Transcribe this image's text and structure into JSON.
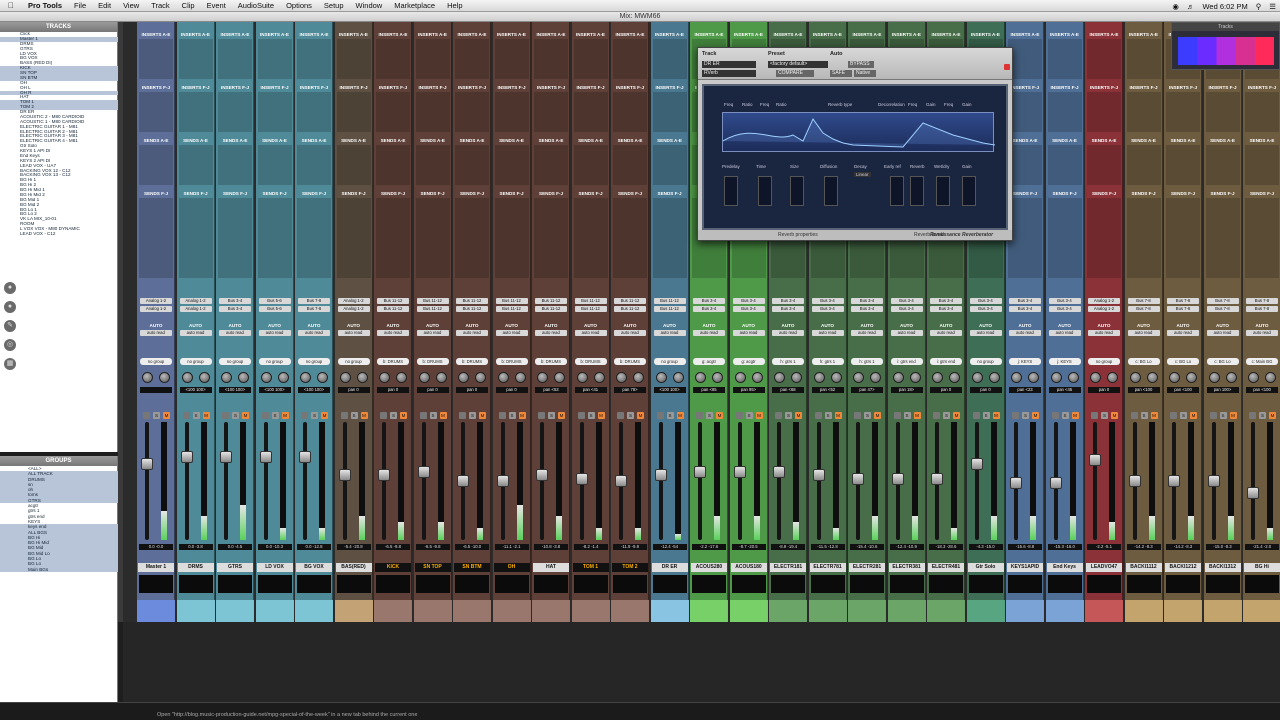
{
  "menubar": {
    "app": "Pro Tools",
    "items": [
      "File",
      "Edit",
      "View",
      "Track",
      "Clip",
      "Event",
      "AudioSuite",
      "Options",
      "Setup",
      "Window",
      "Marketplace",
      "Help"
    ],
    "clock": "Wed 6:02 PM"
  },
  "window_title": "Mix: MWM66",
  "tracks_panel": {
    "title": "TRACKS",
    "rows": [
      "Click",
      "Master 1",
      "DRMS",
      "GTRS",
      "LD VOX",
      "BG VOX",
      "BASS (RED DI)",
      "KICK",
      "SN TOP",
      "SN BTM",
      "OH",
      "OH L",
      "OH R",
      "HAT",
      "TOM 1",
      "TOM 2",
      "DR ER",
      "ACOUSTIC 2 - M80 CARDIOID",
      "ACOUSTIC 1 - M80 CARDIOID",
      "ELECTRIC GUITAR 1 - M81",
      "ELECTRIC GUITAR 2 - M81",
      "ELECTRIC GUITAR 3 - M81",
      "ELECTRIC GUITAR 4 - M81",
      "Gtr Solo",
      "KEYS 1 API DI",
      "End Keys",
      "KEYS 2 API DI",
      "LEAD VOX - UA7",
      "BACKING VOX 12 - C12",
      "BACKING VOX 13 - C12",
      "BG Hi 1",
      "BG Hi 2",
      "BG Hi Mid 1",
      "BG Hi Mid 2",
      "BG Mid 1",
      "BG Mid 2",
      "BG Lo 1",
      "BG Lo 2",
      "VK LA MIX_10-01",
      "ROOM",
      "L VOX VOX - M80 DYNAMIC",
      "LEAD VOX - C12"
    ],
    "selected": [
      1,
      7,
      8,
      9,
      12,
      14,
      15
    ]
  },
  "groups_panel": {
    "title": "GROUPS",
    "rows": [
      "<ALL>",
      "ALL TRACK",
      "DRUMS",
      "sn",
      "oh",
      "toms",
      "GTRS",
      "acgtr",
      "gtrs 1",
      "gtrs end",
      "KEYS",
      "keys end",
      "ALL BGS",
      "BG Hi",
      "BG Hi Mid",
      "BG Mid",
      "BG Mid Lo",
      "BG Lo",
      "BG Lo",
      "Main BGs"
    ],
    "selected": [
      1,
      2,
      3,
      4,
      5,
      6,
      11,
      12,
      13,
      14,
      15,
      16,
      17,
      18,
      19
    ]
  },
  "mixer": {
    "inserts_label": "INSERTS A-E",
    "inserts_fj_label": "INSERTS F-J",
    "sends_label": "SENDS A-E",
    "sends_fj_label": "SENDS F-J",
    "auto_label": "AUTO",
    "auto_mode": "auto read",
    "strips": [
      {
        "name": "Master 1",
        "color": "#5d6f98",
        "swatch": "#6e8ce0",
        "io": "Analog 1-2",
        "grp": "no group",
        "pan": "",
        "vol": "0.0  -0.0",
        "fader": 0.36,
        "meter": 0.25,
        "sel": false
      },
      {
        "name": "DRMS",
        "color": "#4f8a98",
        "swatch": "#7fc8d8",
        "io": "Analog 1-2",
        "grp": "no group",
        "pan": "<100 100>",
        "vol": "0.0  -3.8",
        "fader": 0.3,
        "meter": 0.2,
        "sel": false
      },
      {
        "name": "GTRS",
        "color": "#4f8a98",
        "swatch": "#7fc8d8",
        "io": "Bus 3-4",
        "grp": "no group",
        "pan": "<100 100>",
        "vol": "0.0  -4.5",
        "fader": 0.3,
        "meter": 0.3,
        "sel": false
      },
      {
        "name": "LD VOX",
        "color": "#4f8a98",
        "swatch": "#7fc8d8",
        "io": "Bus 5-6",
        "grp": "no group",
        "pan": "<100 100>",
        "vol": "0.0  -10.3",
        "fader": 0.3,
        "meter": 0.1,
        "sel": false
      },
      {
        "name": "BG VOX",
        "color": "#4f8a98",
        "swatch": "#7fc8d8",
        "io": "Bus 7-8",
        "grp": "no group",
        "pan": "<100 100>",
        "vol": "0.0  -12.8",
        "fader": 0.3,
        "meter": 0.1,
        "sel": false
      },
      {
        "name": "BAS(RED)",
        "color": "#5e5143",
        "swatch": "#c8a878",
        "io": "Analog 1-2",
        "grp": "no group",
        "pan": "pan  0",
        "vol": "-5.4  -20.8",
        "fader": 0.45,
        "meter": 0.2,
        "sel": false
      },
      {
        "name": "KICK",
        "color": "#5e4038",
        "swatch": "#9c7a70",
        "io": "Bus 11-12",
        "grp": "b: DRUMS",
        "pan": "pan  0",
        "vol": "-6.5  -9.8",
        "fader": 0.45,
        "meter": 0.15,
        "sel": true
      },
      {
        "name": "SN TOP",
        "color": "#5e4038",
        "swatch": "#9c7a70",
        "io": "Bus 11-12",
        "grp": "b: DRUMS",
        "pan": "pan  0",
        "vol": "-6.5  -9.8",
        "fader": 0.42,
        "meter": 0.15,
        "sel": true
      },
      {
        "name": "SN BTM",
        "color": "#5e4038",
        "swatch": "#9c7a70",
        "io": "Bus 11-12",
        "grp": "b: DRUMS",
        "pan": "pan  0",
        "vol": "-6.5  -10.0",
        "fader": 0.5,
        "meter": 0.1,
        "sel": true
      },
      {
        "name": "OH",
        "color": "#5e4038",
        "swatch": "#9c7a70",
        "io": "Bus 11-12",
        "grp": "b: DRUMS",
        "pan": "pan  0",
        "vol": "-11.1  -2.1",
        "fader": 0.5,
        "meter": 0.3,
        "sel": true
      },
      {
        "name": "HAT",
        "color": "#5e4038",
        "swatch": "#9c7a70",
        "io": "Bus 11-12",
        "grp": "b: DRUMS",
        "pan": "pan  <53",
        "vol": "-10.8  -3.8",
        "fader": 0.45,
        "meter": 0.2,
        "sel": false
      },
      {
        "name": "TOM 1",
        "color": "#5e4038",
        "swatch": "#9c7a70",
        "io": "Bus 11-12",
        "grp": "b: DRUMS",
        "pan": "pan  <41",
        "vol": "-8.2  -1.4",
        "fader": 0.48,
        "meter": 0.1,
        "sel": true
      },
      {
        "name": "TOM 2",
        "color": "#5e4038",
        "swatch": "#9c7a70",
        "io": "Bus 11-12",
        "grp": "b: DRUMS",
        "pan": "pan  78>",
        "vol": "-11.9  -9.9",
        "fader": 0.5,
        "meter": 0.1,
        "sel": true
      },
      {
        "name": "DR ER",
        "color": "#4a7890",
        "swatch": "#8cc8e8",
        "io": "Bus 11-12",
        "grp": "no group",
        "pan": "<100 100>",
        "vol": "-12.4  -54",
        "fader": 0.45,
        "meter": 0.05,
        "sel": false
      },
      {
        "name": "ACOUS280",
        "color": "#4f9a48",
        "swatch": "#7ad46a",
        "io": "Bus 3-4",
        "grp": "g: acgtr",
        "pan": "pan  <85",
        "vol": "-2.2  -17.6",
        "fader": 0.42,
        "meter": 0.2,
        "sel": false
      },
      {
        "name": "ACOUS180",
        "color": "#4f9a48",
        "swatch": "#7ad46a",
        "io": "Bus 3-4",
        "grp": "g: acgtr",
        "pan": "pan  95>",
        "vol": "-8.7  -20.5",
        "fader": 0.42,
        "meter": 0.2,
        "sel": false
      },
      {
        "name": "ELECTR181",
        "color": "#476e48",
        "swatch": "#6fa86a",
        "io": "Bus 3-4",
        "grp": "h: gtrs 1",
        "pan": "pan  <68",
        "vol": "-8.8  -19.4",
        "fader": 0.42,
        "meter": 0.15,
        "sel": false
      },
      {
        "name": "ELECTR781",
        "color": "#476e48",
        "swatch": "#6fa86a",
        "io": "Bus 3-4",
        "grp": "h: gtrs 1",
        "pan": "pan  <52",
        "vol": "-11.5  -12.8",
        "fader": 0.45,
        "meter": 0.1,
        "sel": false
      },
      {
        "name": "ELECTR281",
        "color": "#476e48",
        "swatch": "#6fa86a",
        "io": "Bus 3-4",
        "grp": "h: gtrs 1",
        "pan": "pan  47>",
        "vol": "-15.4  -10.6",
        "fader": 0.48,
        "meter": 0.2,
        "sel": false
      },
      {
        "name": "ELECTR381",
        "color": "#476e48",
        "swatch": "#6fa86a",
        "io": "Bus 3-4",
        "grp": "i: gtrs end",
        "pan": "pan  18>",
        "vol": "-12.4  -10.9",
        "fader": 0.48,
        "meter": 0.2,
        "sel": false
      },
      {
        "name": "ELECTR481",
        "color": "#476e48",
        "swatch": "#6fa86a",
        "io": "Bus 3-4",
        "grp": "i: gtrs end",
        "pan": "pan  0",
        "vol": "-18.3  -28.6",
        "fader": 0.48,
        "meter": 0.1,
        "sel": false
      },
      {
        "name": "Gtr Solo",
        "color": "#3e6e55",
        "swatch": "#5aa884",
        "io": "Bus 3-4",
        "grp": "no group",
        "pan": "pan  0",
        "vol": "-4.3  -15.0",
        "fader": 0.36,
        "meter": 0.2,
        "sel": false
      },
      {
        "name": "KEYS1APID",
        "color": "#4f6f96",
        "swatch": "#7ea5d8",
        "io": "Bus 3-4",
        "grp": "j: KEYS",
        "pan": "pan  <23",
        "vol": "-15.6  -8.8",
        "fader": 0.52,
        "meter": 0.2,
        "sel": false
      },
      {
        "name": "End Keys",
        "color": "#4f6f96",
        "swatch": "#7ea5d8",
        "io": "Bus 3-4",
        "grp": "j: KEYS",
        "pan": "pan  <45",
        "vol": "-15.3  -16.0",
        "fader": 0.52,
        "meter": 0.2,
        "sel": false
      },
      {
        "name": "LEADVO47",
        "color": "#8a3238",
        "swatch": "#c85a5a",
        "io": "Analog 1-2",
        "grp": "no group",
        "pan": "pan  0",
        "vol": "-2.2  -5.1",
        "fader": 0.32,
        "meter": 0.15,
        "sel": false
      },
      {
        "name": "BACKI1112",
        "color": "#6e5c40",
        "swatch": "#c8a870",
        "io": "Bus 7-8",
        "grp": "c: BG Lo",
        "pan": "pan  <100",
        "vol": "-14.2  -8.3",
        "fader": 0.5,
        "meter": 0.2,
        "sel": false
      },
      {
        "name": "BACKI1212",
        "color": "#6e5c40",
        "swatch": "#c8a870",
        "io": "Bus 7-8",
        "grp": "c: BG Lo",
        "pan": "pan  <100",
        "vol": "-14.2  -8.3",
        "fader": 0.5,
        "meter": 0.2,
        "sel": false
      },
      {
        "name": "BACKI1312",
        "color": "#6e5c40",
        "swatch": "#c8a870",
        "io": "Bus 7-8",
        "grp": "c: BG Lo",
        "pan": "pan  100>",
        "vol": "-15.0  -8.3",
        "fader": 0.5,
        "meter": 0.2,
        "sel": false
      },
      {
        "name": "BG Hi",
        "color": "#6e5c40",
        "swatch": "#c8a870",
        "io": "Bus 7-8",
        "grp": "c: Main BG",
        "pan": "pan  <100",
        "vol": "-21.4  -2.0",
        "fader": 0.6,
        "meter": 0.1,
        "sel": false
      }
    ]
  },
  "plugin": {
    "track_label": "Track",
    "preset_label": "Preset",
    "auto_label": "Auto",
    "track_value": "DR ER",
    "insert_value": "RVerb",
    "preset_value": "<factory default>",
    "compare_label": "COMPARE",
    "safe_label": "SAFE",
    "bypass_label": "BYPASS",
    "native_label": "Native",
    "section_reverb_type": "Reverb type",
    "section_decorrelation": "Decorrelation",
    "eq_labels": [
      "Freq",
      "Ratio",
      "Freq",
      "Ratio",
      "Freq",
      "Gain",
      "Freq",
      "Gain"
    ],
    "ctl_labels": [
      "Predelay",
      "Time",
      "Size",
      "Diffusion",
      "Decay",
      "Early ref",
      "Reverb",
      "Wet/dry",
      "Gain"
    ],
    "decay_value": "Linear",
    "foot_left": "Reverb properties",
    "foot_right": "Reverb levels",
    "brand": "Renaissance Reverberator"
  },
  "widget": {
    "title": "Tracks"
  },
  "status": "Open \"http://blog.music-production-guide.net/mpg-special-of-the-week\" in a new tab behind the current one"
}
